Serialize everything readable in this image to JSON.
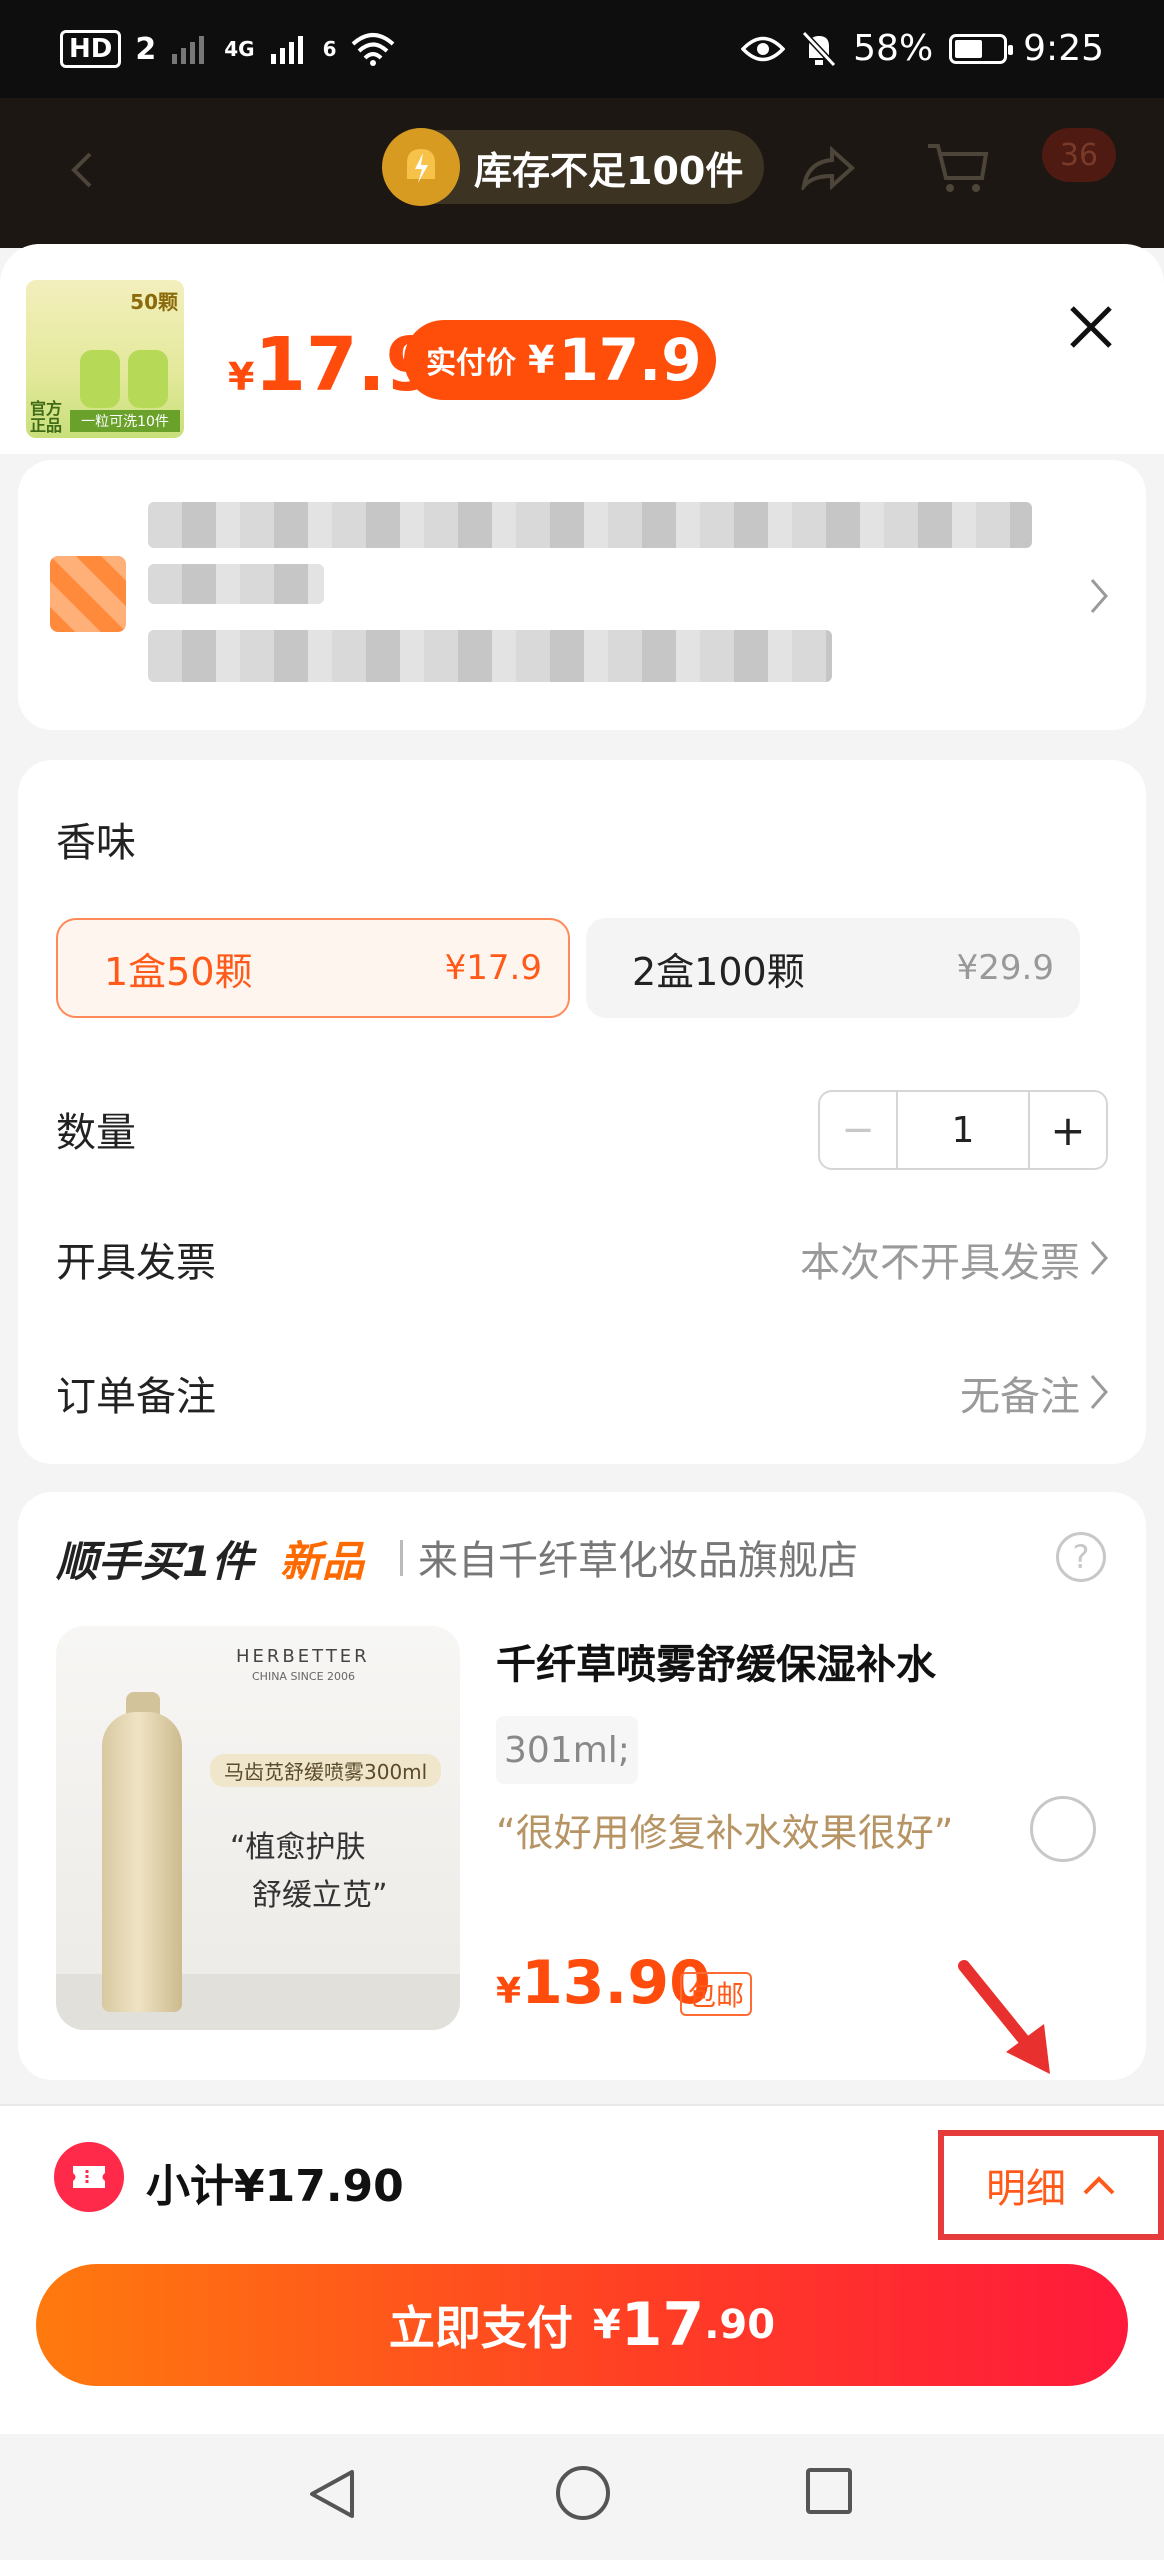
{
  "status_bar": {
    "hd": "HD",
    "sim": "2",
    "network": "4G",
    "wifi": "6",
    "battery": "58%",
    "battery_level": 0.58,
    "time": "9:25"
  },
  "header": {
    "stock_warning": "库存不足100件",
    "cart_count": "36"
  },
  "product": {
    "thumb_badge": "50颗",
    "thumb_left": "官方正品",
    "thumb_bottom": "一粒可洗10件",
    "price_currency": "¥",
    "price": "17.9",
    "pay_label": "实付价",
    "pay_currency": "¥",
    "pay_price": "17.9"
  },
  "spec": {
    "section_title": "香味",
    "options": [
      {
        "label": "1盒50颗",
        "price": "¥17.9",
        "selected": true
      },
      {
        "label": "2盒100颗",
        "price": "¥29.9",
        "selected": false
      }
    ],
    "quantity_label": "数量",
    "quantity_minus": "−",
    "quantity": "1",
    "quantity_plus": "+",
    "invoice_label": "开具发票",
    "invoice_value": "本次不开具发票",
    "remark_label": "订单备注",
    "remark_value": "无备注"
  },
  "upsell": {
    "heading": "顺手买1件",
    "heading_new": "新品",
    "source": "来自千纤草化妆品旗舰店",
    "help": "?",
    "image": {
      "brand": "HERBETTER",
      "brand_sub": "CHINA SINCE 2006",
      "tag": "马齿苋舒缓喷雾300ml",
      "quote_line1": "“植愈护肤",
      "quote_line2": "舒缓立苋”"
    },
    "title": "千纤草喷雾舒缓保湿补水",
    "spec": "301ml;",
    "quote": "“很好用修复补水效果很好”",
    "price_currency": "¥",
    "price": "13.90",
    "shipping": "包邮"
  },
  "footer": {
    "subtotal": "小计¥17.90",
    "detail": "明细",
    "pay_label": "立即支付",
    "pay_currency": "¥",
    "pay_int": "17",
    "pay_dec": ".90"
  },
  "colors": {
    "accent": "#ff4b0b",
    "highlight_box": "#e53b3b"
  }
}
